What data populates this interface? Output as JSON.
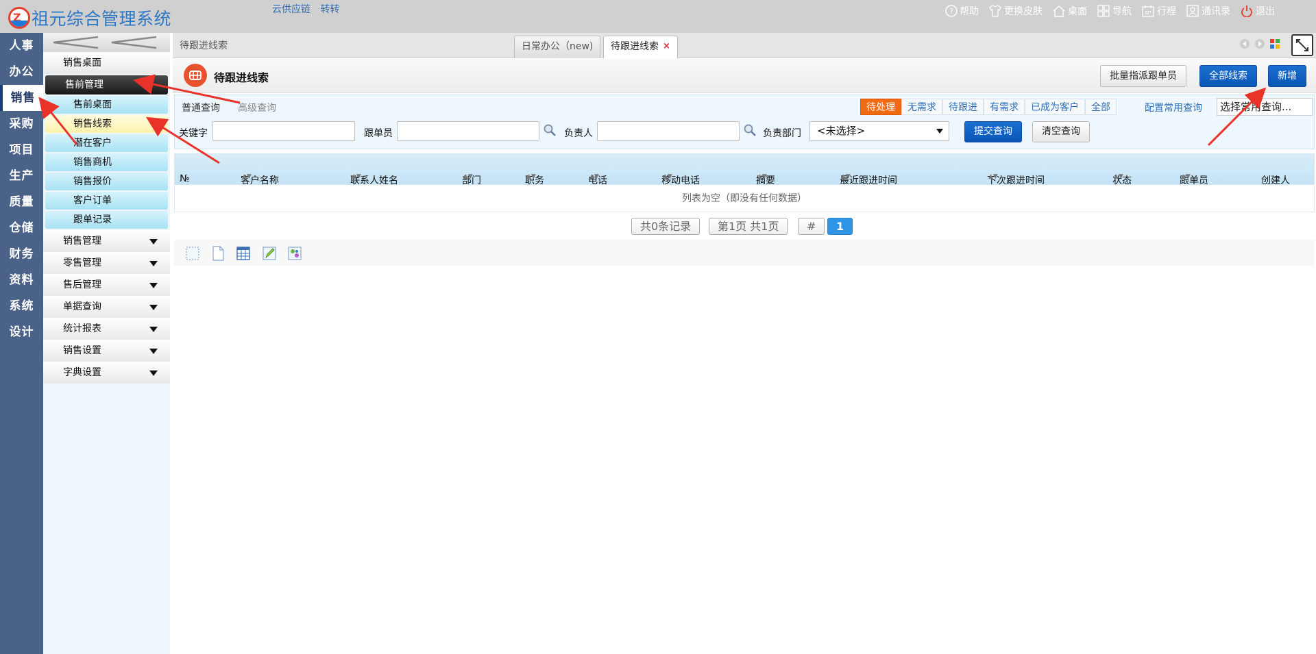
{
  "app": {
    "title": "祖元综合管理系统",
    "top_links": [
      "云供应链",
      "转转"
    ],
    "toolbar": [
      {
        "label": "帮助",
        "icon": "help-icon"
      },
      {
        "label": "更换皮肤",
        "icon": "shirt-icon"
      },
      {
        "label": "桌面",
        "icon": "home-icon"
      },
      {
        "label": "导航",
        "icon": "grid-icon"
      },
      {
        "label": "行程",
        "icon": "calendar-icon"
      },
      {
        "label": "通讯录",
        "icon": "contacts-icon"
      },
      {
        "label": "退出",
        "icon": "power-icon"
      }
    ]
  },
  "modules": [
    "人事",
    "办公",
    "销售",
    "采购",
    "项目",
    "生产",
    "质量",
    "仓储",
    "财务",
    "资料",
    "系统",
    "设计"
  ],
  "active_module": "销售",
  "sidebar": {
    "top_item": "销售桌面",
    "open_group": "售前管理",
    "sub_items": [
      "售前桌面",
      "销售线索",
      "潜在客户",
      "销售商机",
      "销售报价",
      "客户订单",
      "跟单记录"
    ],
    "current_sub": "销售线索",
    "groups": [
      "销售管理",
      "零售管理",
      "售后管理",
      "单据查询",
      "统计报表",
      "销售设置",
      "字典设置"
    ]
  },
  "tabs": {
    "breadcrumb": "待跟进线索",
    "items": [
      {
        "label": "日常办公（new)",
        "closable": false
      },
      {
        "label": "待跟进线索",
        "closable": true
      }
    ]
  },
  "page": {
    "title": "待跟进线索",
    "actions": {
      "batch_assign": "批量指派跟单员",
      "all_leads": "全部线索",
      "add_new": "新增"
    }
  },
  "query": {
    "tab_normal": "普通查询",
    "tab_advanced": "高级查询",
    "filters": [
      "待处理",
      "无需求",
      "待跟进",
      "有需求",
      "已成为客户",
      "全部"
    ],
    "active_filter": "待处理",
    "config_link": "配置常用查询",
    "saved_query_placeholder": "选择常用查询...",
    "keyword_label": "关键字",
    "follower_label": "跟单员",
    "owner_label": "负责人",
    "dept_label": "负责部门",
    "dept_value": "<未选择>",
    "submit": "提交查询",
    "clear": "清空查询"
  },
  "grid": {
    "columns": [
      "№",
      "客户名称",
      "联系人姓名",
      "部门",
      "职务",
      "电话",
      "移动电话",
      "摘要",
      "最近跟进时间",
      "下次跟进时间",
      "状态",
      "跟单员",
      "创建人"
    ],
    "sortable": [
      false,
      true,
      true,
      true,
      true,
      true,
      true,
      true,
      true,
      true,
      true,
      true,
      false
    ],
    "empty_text": "列表为空（即没有任何数据）"
  },
  "pager": {
    "records": "共0条记录",
    "page_info": "第1页 共1页",
    "jump": "#",
    "current": "1"
  },
  "colors": {
    "module_bar": "#4a6188",
    "accent_blue": "#0a56b6",
    "active_filter": "#f06a14",
    "title_icon": "#e9522f"
  }
}
